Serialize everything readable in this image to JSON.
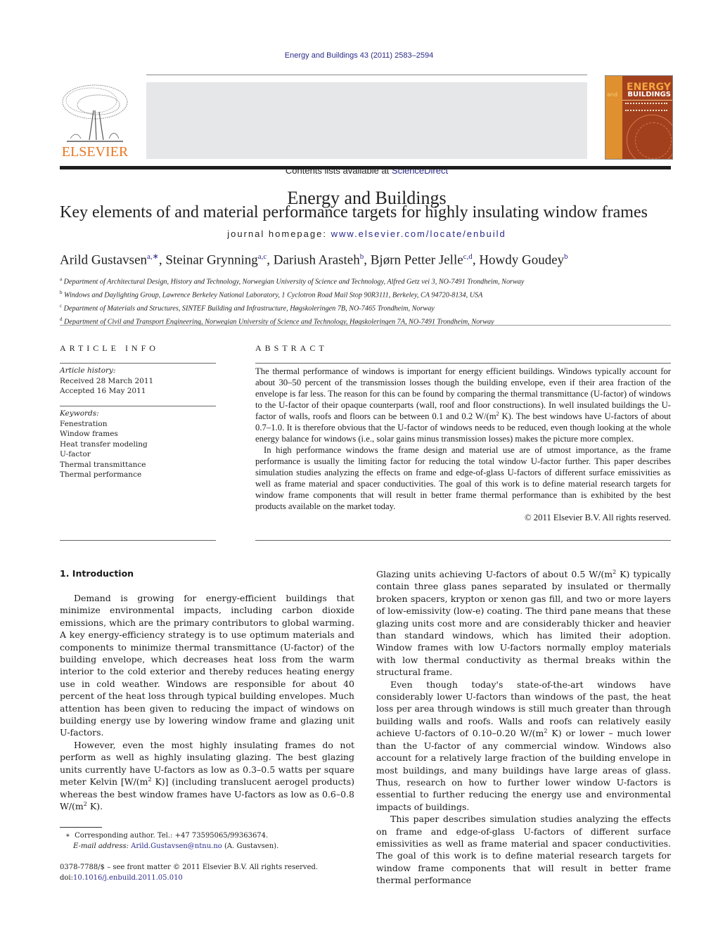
{
  "header": {
    "citation": "Energy and Buildings 43 (2011) 2583–2594",
    "contents_prefix": "Contents lists available at ",
    "contents_link": "ScienceDirect",
    "journal_name": "Energy and Buildings",
    "homepage_prefix": "journal homepage: ",
    "homepage_url": "www.elsevier.com/locate/enbuild",
    "publisher_logo_text": "ELSEVIER",
    "cover": {
      "line1": "ENERGY",
      "line2_small": "and",
      "line2": "BUILDINGS"
    },
    "colors": {
      "link": "#2a2a8a",
      "elsevier_orange": "#e87722",
      "banner_bg": "#e6e7e9",
      "cover_bg": "#a2401e"
    }
  },
  "article": {
    "title": "Key elements of and material performance targets for highly insulating window frames",
    "authors": [
      {
        "name": "Arild Gustavsen",
        "sup": "a,∗"
      },
      {
        "name": "Steinar Grynning",
        "sup": "a,c"
      },
      {
        "name": "Dariush Arasteh",
        "sup": "b"
      },
      {
        "name": "Bjørn Petter Jelle",
        "sup": "c,d"
      },
      {
        "name": "Howdy Goudey",
        "sup": "b"
      }
    ],
    "affiliations": [
      {
        "key": "a",
        "text": "Department of Architectural Design, History and Technology, Norwegian University of Science and Technology, Alfred Getz vei 3, NO-7491 Trondheim, Norway"
      },
      {
        "key": "b",
        "text": "Windows and Daylighting Group, Lawrence Berkeley National Laboratory, 1 Cyclotron Road Mail Stop 90R3111, Berkeley, CA 94720-8134, USA"
      },
      {
        "key": "c",
        "text": "Department of Materials and Structures, SINTEF Building and Infrastructure, Høgskoleringen 7B, NO-7465 Trondheim, Norway"
      },
      {
        "key": "d",
        "text": "Department of Civil and Transport Engineering, Norwegian University of Science and Technology, Høgskoleringen 7A, NO-7491 Trondheim, Norway"
      }
    ]
  },
  "article_info": {
    "heading": "ARTICLE INFO",
    "history_label": "Article history:",
    "received": "Received 28 March 2011",
    "accepted": "Accepted 16 May 2011",
    "keywords_label": "Keywords:",
    "keywords": [
      "Fenestration",
      "Window frames",
      "Heat transfer modeling",
      "U-factor",
      "Thermal transmittance",
      "Thermal performance"
    ]
  },
  "abstract": {
    "heading": "ABSTRACT",
    "p1_a": "The thermal performance of windows is important for energy efficient buildings. Windows typically account for about 30–50 percent of the transmission losses though the building envelope, even if their area fraction of the envelope is far less. The reason for this can be found by comparing the thermal transmittance (U-factor) of windows to the U-factor of their opaque counterparts (wall, roof and floor constructions). In well insulated buildings the U-factor of walls, roofs and floors can be between 0.1 and 0.2 W/(m",
    "p1_sup": "2",
    "p1_b": " K). The best windows have U-factors of about 0.7–1.0. It is therefore obvious that the U-factor of windows needs to be reduced, even though looking at the whole energy balance for windows (i.e., solar gains minus transmission losses) makes the picture more complex.",
    "p2": "In high performance windows the frame design and material use are of utmost importance, as the frame performance is usually the limiting factor for reducing the total window U-factor further. This paper describes simulation studies analyzing the effects on frame and edge-of-glass U-factors of different surface emissivities as well as frame material and spacer conductivities. The goal of this work is to define material research targets for window frame components that will result in better frame thermal performance than is exhibited by the best products available on the market today.",
    "copyright": "© 2011 Elsevier B.V. All rights reserved."
  },
  "body": {
    "section_heading": "1.  Introduction",
    "left_p1": "Demand is growing for energy-efficient buildings that minimize environmental impacts, including carbon dioxide emissions, which are the primary contributors to global warming. A key energy-efficiency strategy is to use optimum materials and components to minimize thermal transmittance (U-factor) of the building envelope, which decreases heat loss from the warm interior to the cold exterior and thereby reduces heating energy use in cold weather. Windows are responsible for about 40 percent of the heat loss through typical building envelopes. Much attention has been given to reducing the impact of windows on building energy use by lowering window frame and glazing unit U-factors.",
    "left_p2_a": "However, even the most highly insulating frames do not perform as well as highly insulating glazing. The best glazing units currently have U-factors as low as 0.3–0.5 watts per square meter Kelvin [W/(m",
    "left_p2_b": " K)] (including translucent aerogel products) whereas the best window frames have U-factors as low as 0.6–0.8 W/(m",
    "left_p2_c": " K).",
    "right_p1_a": "Glazing units achieving U-factors of about 0.5 W/(m",
    "right_p1_b": " K) typically contain three glass panes separated by insulated or thermally broken spacers, krypton or xenon gas fill, and two or more layers of low-emissivity (low-e) coating. The third pane means that these glazing units cost more and are considerably thicker and heavier than standard windows, which has limited their adoption. Window frames with low U-factors normally employ materials with low thermal conductivity as thermal breaks within the structural frame.",
    "right_p2_a": "Even though today's state-of-the-art windows have considerably lower U-factors than windows of the past, the heat loss per area through windows is still much greater than through building walls and roofs. Walls and roofs can relatively easily achieve U-factors of 0.10–0.20 W/(m",
    "right_p2_b": " K) or lower – much lower than the U-factor of any commercial window. Windows also account for a relatively large fraction of the building envelope in most buildings, and many buildings have large areas of glass. Thus, research on how to further lower window U-factors is essential to further reducing the energy use and environmental impacts of buildings.",
    "right_p3": "This paper describes simulation studies analyzing the effects on frame and edge-of-glass U-factors of different surface emissivities as well as frame material and spacer conductivities. The goal of this work is to define material research targets for window frame components that will result in better frame thermal performance",
    "sup2": "2"
  },
  "footnote": {
    "marker": "∗",
    "corresponding": "Corresponding author. Tel.: +47 73595065/99363674.",
    "email_label": "E-mail address:",
    "email": "Arild.Gustavsen@ntnu.no",
    "email_suffix": " (A. Gustavsen).",
    "issn": "0378-7788/$ – see front matter © 2011 Elsevier B.V. All rights reserved.",
    "doi_prefix": "doi:",
    "doi": "10.1016/j.enbuild.2011.05.010"
  }
}
